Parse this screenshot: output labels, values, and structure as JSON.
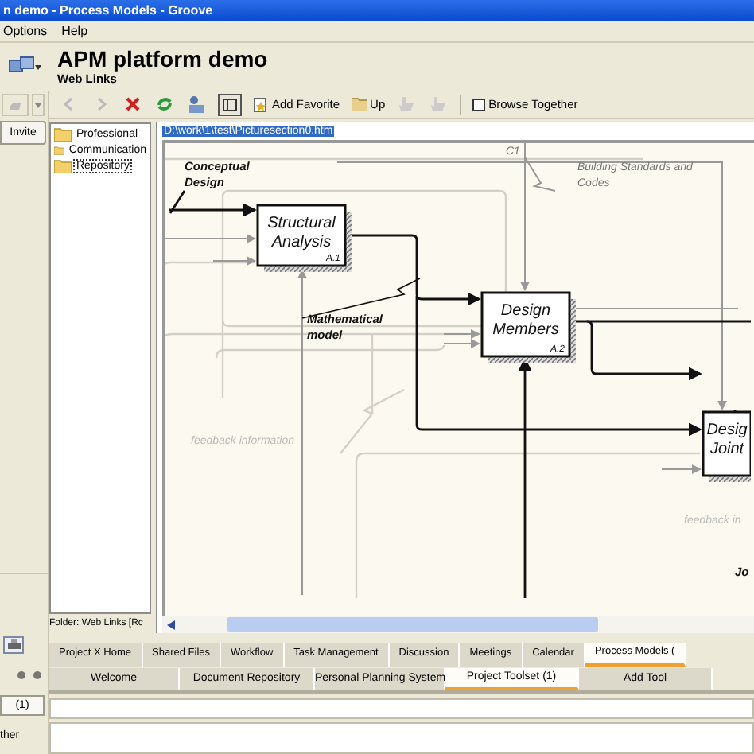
{
  "window": {
    "title": "n demo - Process Models - Groove"
  },
  "menu": [
    "Options",
    "Help"
  ],
  "header": {
    "title": "APM platform demo",
    "subtitle": "Web Links"
  },
  "side_strip": {
    "invite_button": "Invite",
    "count_button": "(1)",
    "footer_text": "ther"
  },
  "toolbar": {
    "add_favorite": "Add Favorite",
    "up": "Up",
    "browse_together": {
      "label": "Browse Together",
      "checked": false
    }
  },
  "folders": {
    "items": [
      {
        "label": "Professional",
        "selected": false
      },
      {
        "label": "Communication",
        "selected": false
      },
      {
        "label": "Repository",
        "selected": true
      }
    ],
    "status": "Folder: Web Links [Rc"
  },
  "browser": {
    "address": "D:\\work\\1\\test\\Picturesection0.htm"
  },
  "diagram": {
    "nodes": [
      {
        "lines": [
          "Structural",
          "Analysis"
        ],
        "code": "A.1"
      },
      {
        "lines": [
          "Design",
          "Members"
        ],
        "code": "A.2"
      },
      {
        "lines": [
          "Desig",
          "Joint"
        ]
      }
    ],
    "labels": [
      {
        "lines": [
          "Conceptual",
          "Design"
        ],
        "kind": "strong"
      },
      {
        "lines": [
          "C1"
        ],
        "kind": "control"
      },
      {
        "lines": [
          "Building Standards and",
          "Codes"
        ],
        "kind": "control"
      },
      {
        "lines": [
          "Mathematical",
          "model"
        ],
        "kind": "strong"
      },
      {
        "lines": [
          "feedback information"
        ],
        "kind": "faint"
      },
      {
        "lines": [
          "feedback in"
        ],
        "kind": "faint"
      },
      {
        "lines": [
          "Jo"
        ],
        "kind": "strong"
      }
    ]
  },
  "tabs": [
    {
      "label": "Project X Home",
      "selected": false
    },
    {
      "label": "Shared Files",
      "selected": false
    },
    {
      "label": "Workflow",
      "selected": false
    },
    {
      "label": "Task Management",
      "selected": false
    },
    {
      "label": "Discussion",
      "selected": false
    },
    {
      "label": "Meetings",
      "selected": false
    },
    {
      "label": "Calendar",
      "selected": false
    },
    {
      "label": "Process Models (",
      "selected": true
    }
  ],
  "subtabs": [
    {
      "label": "Welcome",
      "selected": false
    },
    {
      "label": "Document Repository",
      "selected": false
    },
    {
      "label": "Personal Planning System",
      "selected": false
    },
    {
      "label": "Project Toolset (1)",
      "selected": true
    },
    {
      "label": "Add Tool",
      "selected": false
    }
  ]
}
